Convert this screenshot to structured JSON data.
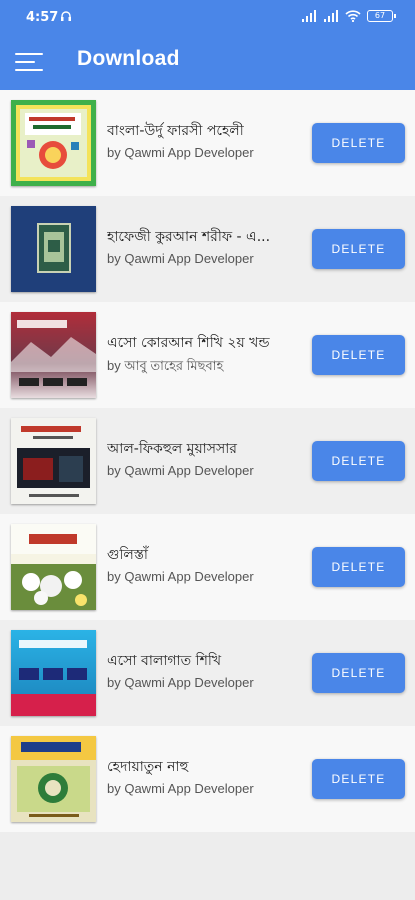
{
  "status_bar": {
    "time": "4:57",
    "battery": "67"
  },
  "app_bar": {
    "title": "Download"
  },
  "colors": {
    "primary": "#4a86e8"
  },
  "books": [
    {
      "title": "বাংলা-উর্দু ফারসী পহেলী",
      "author": "by Qawmi App Developer",
      "delete_label": "DELETE"
    },
    {
      "title": "হাফেজী কুরআন শরীফ - এ...",
      "author": "by Qawmi App Developer",
      "delete_label": "DELETE"
    },
    {
      "title": "এসো কোরআন শিখি ২য় খন্ড",
      "author": "by আবু তাহের মিছবাহ",
      "delete_label": "DELETE"
    },
    {
      "title": "আল-ফিকহুল মুয়াসসার",
      "author": "by Qawmi App Developer",
      "delete_label": "DELETE"
    },
    {
      "title": "গুলিস্তাঁ",
      "author": "by Qawmi App Developer",
      "delete_label": "DELETE"
    },
    {
      "title": "এসো বালাগাত শিখি",
      "author": "by Qawmi App Developer",
      "delete_label": "DELETE"
    },
    {
      "title": "হেদায়াতুন নাহু",
      "author": "by Qawmi App Developer",
      "delete_label": "DELETE"
    }
  ]
}
